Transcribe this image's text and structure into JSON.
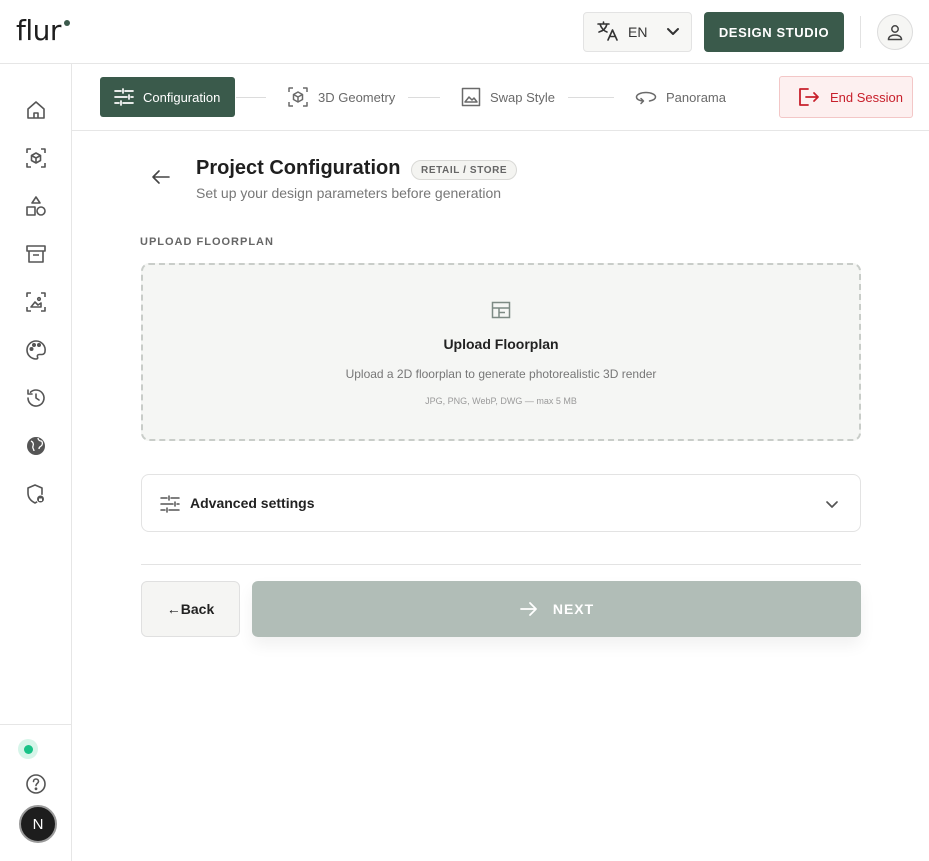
{
  "header": {
    "logo_text": "flur",
    "language": "EN",
    "design_studio_label": "DESIGN STUDIO"
  },
  "sidebar": {
    "items": [
      {
        "icon": "home-icon"
      },
      {
        "icon": "cube-icon"
      },
      {
        "icon": "shapes-icon"
      },
      {
        "icon": "archive-icon"
      },
      {
        "icon": "image-frame-icon"
      },
      {
        "icon": "palette-icon"
      },
      {
        "icon": "history-icon"
      },
      {
        "icon": "globe-icon"
      },
      {
        "icon": "shield-lock-icon"
      }
    ],
    "avatar_initial": "N",
    "status_color": "#19c287"
  },
  "stepper": {
    "steps": [
      {
        "label": "Configuration",
        "icon": "sliders-icon",
        "active": true
      },
      {
        "label": "3D Geometry",
        "icon": "cube-outline-icon",
        "active": false
      },
      {
        "label": "Swap Style",
        "icon": "image-icon",
        "active": false
      },
      {
        "label": "Panorama",
        "icon": "panorama-icon",
        "active": false
      }
    ],
    "end_session_label": "End Session"
  },
  "main": {
    "title": "Project Configuration",
    "badge": "RETAIL / STORE",
    "subtitle": "Set up your design parameters before generation",
    "upload_section_label": "UPLOAD FLOORPLAN",
    "upload": {
      "title": "Upload Floorplan",
      "description": "Upload a 2D floorplan to generate photorealistic 3D render",
      "formats": "JPG, PNG, WebP, DWG — max 5 MB"
    },
    "advanced_label": "Advanced settings",
    "back_label": "←Back",
    "next_label": "NEXT"
  },
  "colors": {
    "primary": "#3a5a4b",
    "danger": "#c8202c",
    "next_disabled": "#b1bdb7"
  }
}
